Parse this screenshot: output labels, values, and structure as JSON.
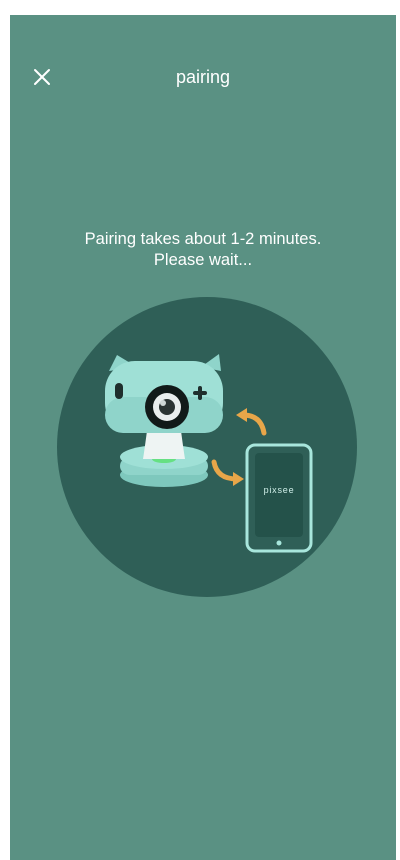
{
  "header": {
    "title": "pairing",
    "close_icon": "close-icon"
  },
  "main": {
    "message_line1": "Pairing takes about 1-2 minutes.",
    "message_line2": "Please wait..."
  },
  "illustration": {
    "phone_brand": "pixsee",
    "colors": {
      "background": "#5a9183",
      "circle": "#2f5f57",
      "camera_body": "#8fd4ca",
      "arrow": "#e8a649",
      "phone_outline": "#a8e6dc"
    }
  }
}
